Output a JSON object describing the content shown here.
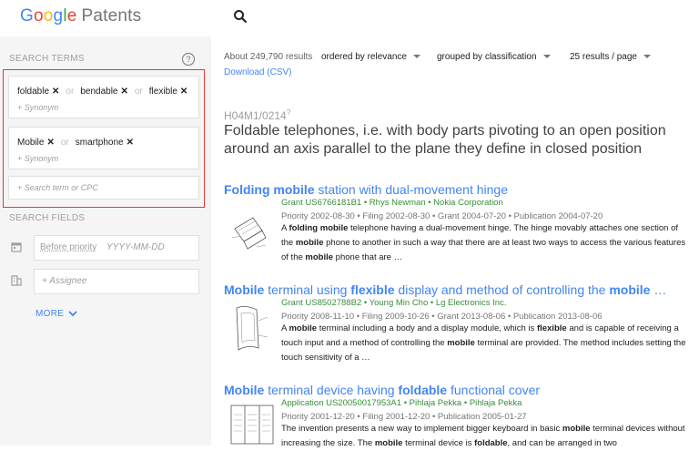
{
  "header": {
    "logo_google": [
      "G",
      "o",
      "o",
      "g",
      "l",
      "e"
    ],
    "logo_patents": "Patents",
    "search_icon": "search-icon"
  },
  "sidebar": {
    "search_terms_label": "SEARCH TERMS",
    "help_icon": "?",
    "group1": {
      "chips": [
        "foldable",
        "bendable",
        "flexible"
      ],
      "or": "or",
      "synonym": "+ Synonym"
    },
    "group2": {
      "chips": [
        "Mobile",
        "smartphone"
      ],
      "or": "or",
      "synonym": "+ Synonym"
    },
    "add_term_placeholder": "+ Search term or CPC",
    "search_fields_label": "SEARCH FIELDS",
    "before_priority": "Before priority",
    "date_placeholder": "YYYY-MM-DD",
    "assignee_placeholder": "+ Assignee",
    "more_label": "MORE",
    "chip_remove": "✕"
  },
  "results_meta": {
    "count": "About 249,790 results",
    "order": "ordered by relevance",
    "grouped": "grouped by classification",
    "per_page": "25 results / page",
    "download": "Download (CSV)"
  },
  "cpc": {
    "code": "H04M1/0214",
    "sup": "?",
    "description": "Foldable telephones, i.e. with body parts pivoting to an open position around an axis parallel to the plane they define in closed position"
  },
  "results": [
    {
      "title_parts": [
        [
          "Folding mobile",
          true
        ],
        [
          " station with dual-movement hinge",
          false
        ]
      ],
      "grant": "Grant US6766181B1 • Rhys Newman • Nokia Corporation",
      "dates": "Priority 2002-08-30 • Filing 2002-08-30 • Grant 2004-07-20 • Publication 2004-07-20",
      "snippet_parts": [
        [
          "A ",
          false
        ],
        [
          "folding mobile",
          true
        ],
        [
          " telephone having a dual-movement hinge. The hinge movably attaches one section of the ",
          false
        ],
        [
          "mobile",
          true
        ],
        [
          " phone to another in such a way that there are at least two ways to access the various features of the ",
          false
        ],
        [
          "mobile",
          true
        ],
        [
          " phone that are …",
          false
        ]
      ]
    },
    {
      "title_parts": [
        [
          "Mobile",
          true
        ],
        [
          " terminal using ",
          false
        ],
        [
          "flexible",
          true
        ],
        [
          " display and method of controlling the ",
          false
        ],
        [
          "mobile",
          true
        ],
        [
          " …",
          false
        ]
      ],
      "grant": "Grant US8502788B2 • Young Min Cho • Lg Electronics Inc.",
      "dates": "Priority 2008-11-10 • Filing 2009-10-26 • Grant 2013-08-06 • Publication 2013-08-06",
      "snippet_parts": [
        [
          "A ",
          false
        ],
        [
          "mobile",
          true
        ],
        [
          " terminal including a body and a display module, which is ",
          false
        ],
        [
          "flexible",
          true
        ],
        [
          " and is capable of receiving a touch input and a method of controlling the ",
          false
        ],
        [
          "mobile",
          true
        ],
        [
          " terminal are provided. The method includes setting the touch sensitivity of a …",
          false
        ]
      ]
    },
    {
      "title_parts": [
        [
          "Mobile",
          true
        ],
        [
          " terminal device having ",
          false
        ],
        [
          "foldable",
          true
        ],
        [
          " functional cover",
          false
        ]
      ],
      "grant": "Application US20050017953A1 • Pihlaja Pekka • Pihlaja Pekka",
      "dates": "Priority 2001-12-20 • Filing 2001-12-20 • Publication 2005-01-27",
      "snippet_parts": [
        [
          "The invention presents a new way to implement bigger keyboard in basic ",
          false
        ],
        [
          "mobile",
          true
        ],
        [
          " terminal devices without increasing the size. The ",
          false
        ],
        [
          "mobile",
          true
        ],
        [
          " terminal device is ",
          false
        ],
        [
          "foldable",
          true
        ],
        [
          ", and can be arranged in two",
          false
        ]
      ]
    }
  ]
}
